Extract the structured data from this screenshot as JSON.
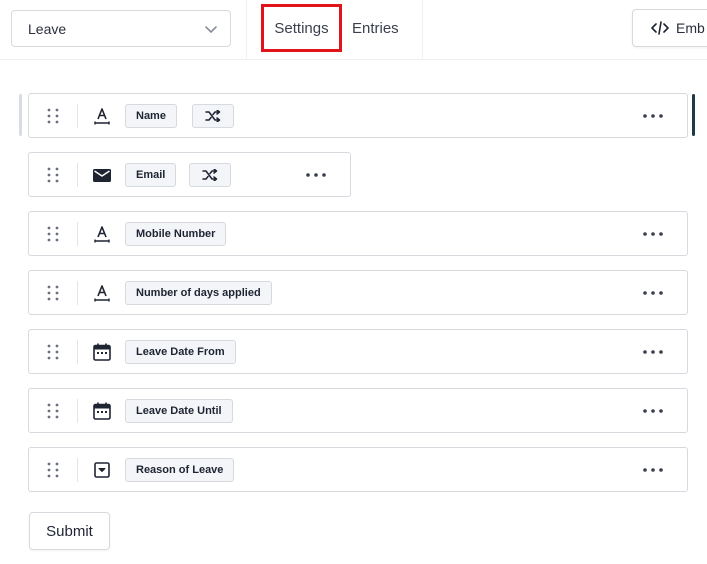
{
  "header": {
    "form_select_value": "Leave",
    "tabs": [
      {
        "label": "Settings"
      },
      {
        "label": "Entries"
      }
    ],
    "embed_label": "Emb"
  },
  "fields": [
    {
      "label": "Name",
      "icon": "text-field-icon",
      "shuffle": true
    },
    {
      "label": "Email",
      "icon": "email-icon",
      "shuffle": true
    },
    {
      "label": "Mobile Number",
      "icon": "text-field-icon",
      "shuffle": false
    },
    {
      "label": "Number of days applied",
      "icon": "text-field-icon",
      "shuffle": false
    },
    {
      "label": "Leave Date From",
      "icon": "calendar-icon",
      "shuffle": false
    },
    {
      "label": "Leave Date Until",
      "icon": "calendar-icon",
      "shuffle": false
    },
    {
      "label": "Reason of Leave",
      "icon": "dropdown-icon",
      "shuffle": false
    }
  ],
  "submit_label": "Submit",
  "colors": {
    "highlight": "#e1141b",
    "active_indicator": "#1d3b46",
    "border": "#d6d9de",
    "chip_bg": "#f3f5f8"
  }
}
